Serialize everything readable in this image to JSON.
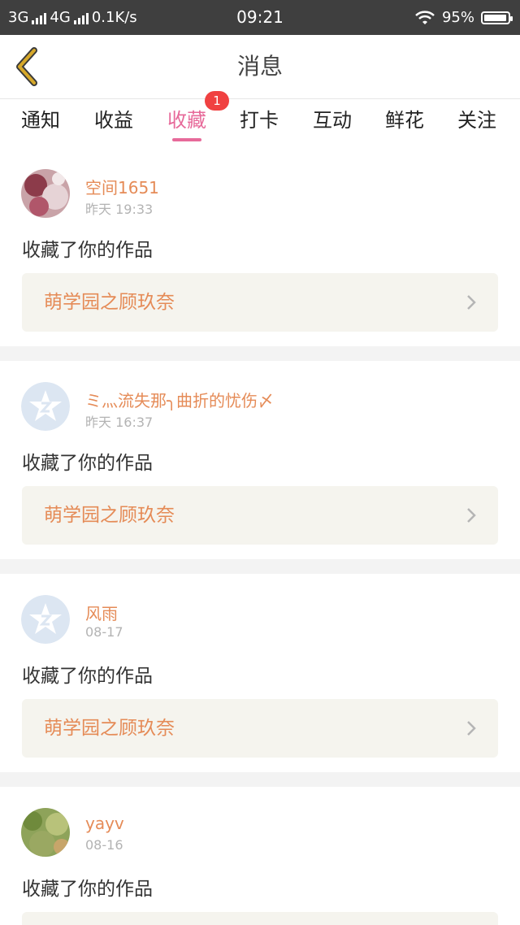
{
  "status_bar": {
    "network1": "3G",
    "network2": "4G",
    "speed": "0.1K/s",
    "time": "09:21",
    "battery": "95%",
    "battery_level": 0.95
  },
  "header": {
    "title": "消息"
  },
  "tabs": [
    {
      "label": "通知"
    },
    {
      "label": "收益"
    },
    {
      "label": "收藏",
      "active": true,
      "badge": "1"
    },
    {
      "label": "打卡"
    },
    {
      "label": "互动"
    },
    {
      "label": "鲜花"
    },
    {
      "label": "关注"
    }
  ],
  "feed": [
    {
      "user": "空间1651",
      "time": "昨天 19:33",
      "action": "收藏了你的作品",
      "work": "萌学园之顾玖奈",
      "avatar": "photo-avatar"
    },
    {
      "user": "ミ灬流失那╮曲折的忧伤〆",
      "time": "昨天 16:37",
      "action": "收藏了你的作品",
      "work": "萌学园之顾玖奈",
      "avatar": "default-avatar"
    },
    {
      "user": "风雨",
      "time": "08-17",
      "action": "收藏了你的作品",
      "work": "萌学园之顾玖奈",
      "avatar": "default-avatar"
    },
    {
      "user": "yayv",
      "time": "08-16",
      "action": "收藏了你的作品",
      "work": "",
      "avatar": "photo-avatar"
    }
  ],
  "colors": {
    "accent_pink": "#e76a9a",
    "name_orange": "#e58b57",
    "badge_red": "#f04141",
    "back_arrow": "#d6a82a"
  }
}
